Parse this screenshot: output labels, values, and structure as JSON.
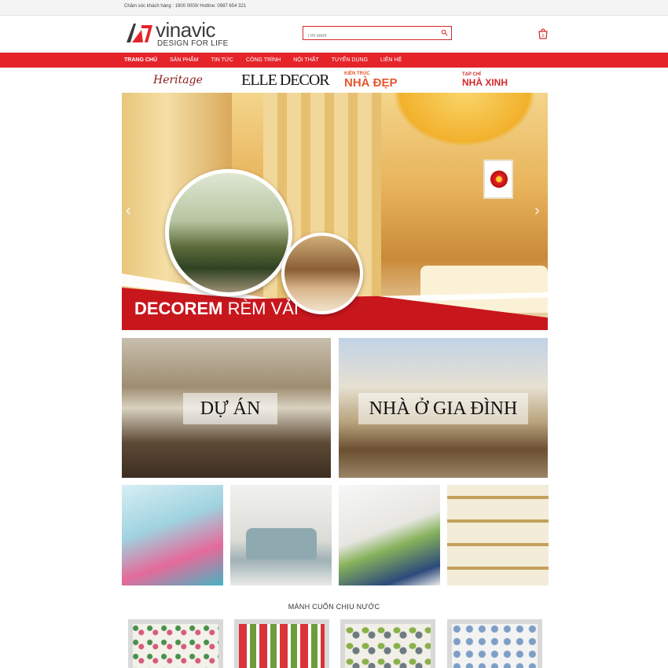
{
  "topbar": {
    "contact": "Chăm sóc khách hàng : 1900 0000/ Hotline: 0987 654 321"
  },
  "header": {
    "logo_text": "vinavic",
    "logo_tagline": "DESIGN FOR LIFE",
    "search_placeholder": "Tìm kiếm",
    "cart_count": "0"
  },
  "nav": {
    "items": [
      "TRANG CHỦ",
      "SẢN PHẨM",
      "TIN TỨC",
      "CÔNG TRÌNH",
      "NỘI THẤT",
      "TUYỂN DỤNG",
      "LIÊN HỆ"
    ]
  },
  "brands": {
    "heritage": "Heritage",
    "elle": "ELLE DECOR",
    "kientruc_top": "KIẾN TRÚC",
    "kientruc": "NHÀ ĐẸP",
    "nhaxinh_top": "TẠP CHÍ",
    "nhaxinh": "NHÀ XINH"
  },
  "slider": {
    "caption_bold": "DECOREM",
    "caption_light": "RÈM VẢI"
  },
  "tiles": {
    "big": [
      "DỰ ÁN",
      "NHÀ Ở GIA ĐÌNH"
    ]
  },
  "section": {
    "title": "MÀNH CUỐN CHỊU NƯỚC"
  },
  "colors": {
    "brand_red": "#e5242a",
    "dark_red": "#c8161d"
  }
}
